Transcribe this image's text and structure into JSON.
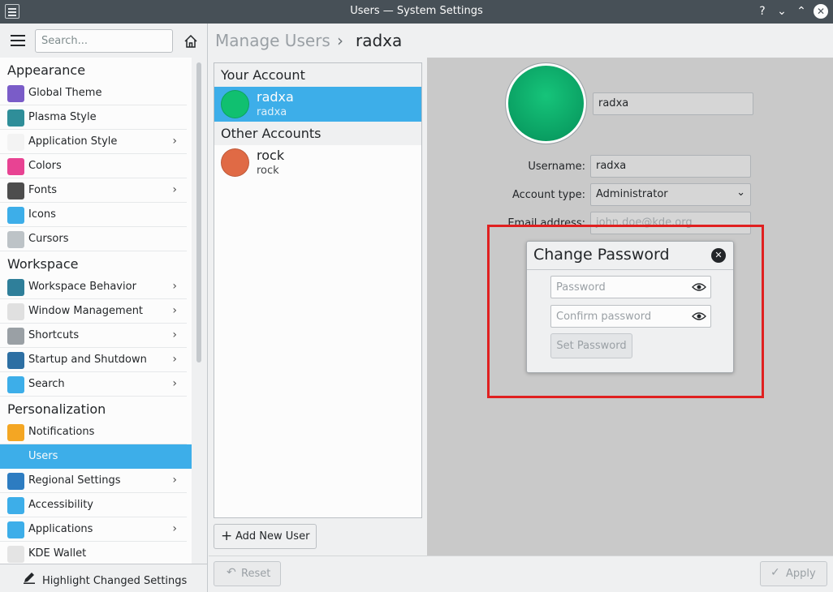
{
  "window": {
    "title": "Users — System Settings",
    "controls": {
      "help": "?",
      "minimize": "⌄",
      "maximize": "⌃",
      "close": "✕"
    }
  },
  "sidebar": {
    "search_placeholder": "Search...",
    "sections": [
      {
        "title": "Appearance",
        "items": [
          {
            "label": "Global Theme",
            "icon": "global-theme-icon",
            "color": "#7a5cc8",
            "chevron": false
          },
          {
            "label": "Plasma Style",
            "icon": "plasma-style-icon",
            "color": "#2f8e99",
            "chevron": false
          },
          {
            "label": "Application Style",
            "icon": "application-style-icon",
            "color": "#f3f3f3",
            "chevron": true
          },
          {
            "label": "Colors",
            "icon": "colors-icon",
            "color": "#e84393",
            "chevron": false
          },
          {
            "label": "Fonts",
            "icon": "fonts-icon",
            "color": "#4d4d4d",
            "chevron": true
          },
          {
            "label": "Icons",
            "icon": "icons-icon",
            "color": "#3daee9",
            "chevron": false
          },
          {
            "label": "Cursors",
            "icon": "cursors-icon",
            "color": "#bdc3c7",
            "chevron": false
          }
        ]
      },
      {
        "title": "Workspace",
        "items": [
          {
            "label": "Workspace Behavior",
            "icon": "workspace-behavior-icon",
            "color": "#2f7f9a",
            "chevron": true
          },
          {
            "label": "Window Management",
            "icon": "window-management-icon",
            "color": "#e0e0e0",
            "chevron": true
          },
          {
            "label": "Shortcuts",
            "icon": "shortcuts-icon",
            "color": "#9aa0a5",
            "chevron": true
          },
          {
            "label": "Startup and Shutdown",
            "icon": "startup-shutdown-icon",
            "color": "#2d6fa3",
            "chevron": true
          },
          {
            "label": "Search",
            "icon": "search-icon",
            "color": "#3daee9",
            "chevron": true
          }
        ]
      },
      {
        "title": "Personalization",
        "items": [
          {
            "label": "Notifications",
            "icon": "notifications-icon",
            "color": "#f4a623",
            "chevron": false
          },
          {
            "label": "Users",
            "icon": "users-icon",
            "color": "#3daee9",
            "chevron": false,
            "active": true
          },
          {
            "label": "Regional Settings",
            "icon": "regional-settings-icon",
            "color": "#2d7cc1",
            "chevron": true
          },
          {
            "label": "Accessibility",
            "icon": "accessibility-icon",
            "color": "#3daee9",
            "chevron": false
          },
          {
            "label": "Applications",
            "icon": "applications-icon",
            "color": "#3daee9",
            "chevron": true
          },
          {
            "label": "KDE Wallet",
            "icon": "kde-wallet-icon",
            "color": "#e4e4e4",
            "chevron": false
          }
        ]
      }
    ],
    "highlight_changed": "Highlight Changed Settings"
  },
  "header": {
    "breadcrumb_parent": "Manage Users",
    "breadcrumb_separator": "›",
    "breadcrumb_current": "radxa"
  },
  "accounts": {
    "your_account_label": "Your Account",
    "other_accounts_label": "Other Accounts",
    "your_account": {
      "name": "radxa",
      "username": "radxa",
      "avatar_color": "#10c070"
    },
    "others": [
      {
        "name": "rock",
        "username": "rock",
        "avatar_color": "#e06a45"
      }
    ],
    "add_user_label": "Add New User"
  },
  "details": {
    "full_name_value": "radxa",
    "username_label": "Username:",
    "username_value": "radxa",
    "account_type_label": "Account type:",
    "account_type_value": "Administrator",
    "email_label": "Email address:",
    "email_placeholder": "john.doe@kde.org"
  },
  "dialog": {
    "title": "Change Password",
    "password_placeholder": "Password",
    "confirm_placeholder": "Confirm password",
    "set_password_label": "Set Password"
  },
  "footer": {
    "reset_label": "Reset",
    "apply_label": "Apply"
  },
  "colors": {
    "accent": "#3daee9",
    "titlebar": "#475057",
    "highlight_box": "#e02020"
  }
}
